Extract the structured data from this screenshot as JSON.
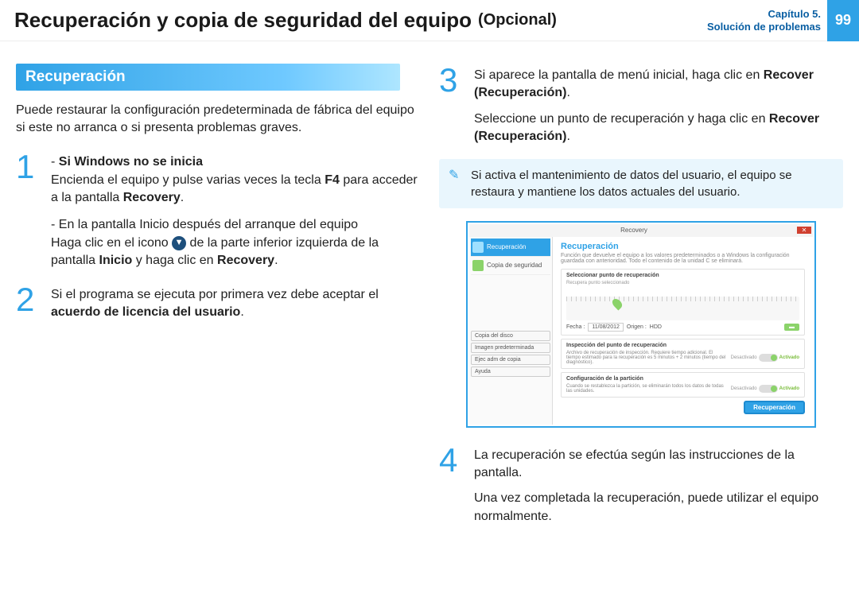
{
  "header": {
    "title": "Recuperación y copia de seguridad del equipo",
    "optional": "(Opcional)",
    "chapter_line1": "Capítulo 5.",
    "chapter_line2": "Solución de problemas",
    "page": "99"
  },
  "left": {
    "section_title": "Recuperación",
    "intro": "Puede restaurar la configuración predeterminada de fábrica del equipo si este no arranca o si presenta problemas graves.",
    "step1": {
      "num": "1",
      "bullet_a_title": "Si Windows no se inicia",
      "bullet_a_body_1": "Encienda el equipo y pulse varias veces la tecla ",
      "bullet_a_key": "F4",
      "bullet_a_body_2": " para acceder a la pantalla ",
      "bullet_a_bold": "Recovery",
      "bullet_a_end": ".",
      "bullet_b_lead": "En la pantalla Inicio después del arranque del equipo",
      "bullet_b_body_1": "Haga clic en el icono ",
      "bullet_b_body_2": " de la parte inferior izquierda de la pantalla ",
      "bullet_b_bold1": "Inicio",
      "bullet_b_mid": " y haga clic en ",
      "bullet_b_bold2": "Recovery",
      "bullet_b_end": "."
    },
    "step2": {
      "num": "2",
      "body_1": "Si el programa se ejecuta por primera vez debe aceptar el ",
      "bold": "acuerdo de licencia del usuario",
      "body_2": "."
    }
  },
  "right": {
    "step3": {
      "num": "3",
      "p1_1": "Si aparece la pantalla de menú inicial, haga clic en ",
      "p1_bold": "Recover (Recuperación)",
      "p1_2": ".",
      "p2_1": "Seleccione un punto de recuperación y haga clic en ",
      "p2_bold": "Recover (Recuperación)",
      "p2_2": "."
    },
    "callout": "Si activa el mantenimiento de datos del usuario, el equipo se restaura y mantiene los datos actuales del usuario.",
    "step4": {
      "num": "4",
      "p1": "La recuperación se efectúa según las instrucciones de la pantalla.",
      "p2": "Una vez completada la recuperación, puede utilizar el equipo normalmente."
    }
  },
  "mock": {
    "window_title": "Recovery",
    "side_active": "Recuperación",
    "side_item": "Copia de seguridad",
    "side_btn1": "Copia del disco",
    "side_btn2": "Imagen predeterminada",
    "side_btn3": "Ejec adm de copia",
    "side_btn4": "Ayuda",
    "main_h": "Recuperación",
    "main_sub": "Función que devuelve el equipo a los valores predeterminados o a Windows la configuración guardada con anterioridad. Todo el contenido de la unidad C se eliminará.",
    "panel1_h": "Seleccionar punto de recuperación",
    "panel1_sub": "Recupera punto seleccionado",
    "date_label": "Fecha :",
    "date_value": "11/08/2012",
    "origin_label": "Origen :",
    "origin_value": "HDD",
    "panel2_h": "Inspección del punto de recuperación",
    "panel2_body": "Archivo de recuperación de inspección. Requiere tiempo adicional. El tiempo estimado para la recuperación es 5 minutos + 2 minutos (tiempo del diagnóstico).",
    "panel3_h": "Configuración de la partición",
    "panel3_body": "Cuando se restablezca la partición, se eliminarán todos los datos de todas las unidades.",
    "toggle_off": "Desactivado",
    "toggle_on": "Activado",
    "action": "Recuperación"
  }
}
